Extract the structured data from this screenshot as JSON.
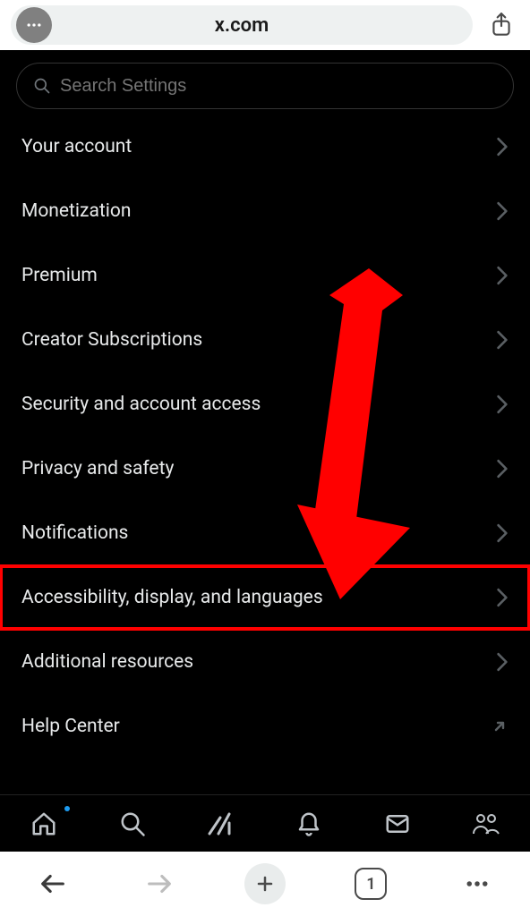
{
  "browser": {
    "url": "x.com",
    "tab_count": "1"
  },
  "search": {
    "placeholder": "Search Settings"
  },
  "settings": {
    "items": [
      {
        "label": "Your account",
        "external": false,
        "highlight": false
      },
      {
        "label": "Monetization",
        "external": false,
        "highlight": false
      },
      {
        "label": "Premium",
        "external": false,
        "highlight": false
      },
      {
        "label": "Creator Subscriptions",
        "external": false,
        "highlight": false
      },
      {
        "label": "Security and account access",
        "external": false,
        "highlight": false
      },
      {
        "label": "Privacy and safety",
        "external": false,
        "highlight": false
      },
      {
        "label": "Notifications",
        "external": false,
        "highlight": false
      },
      {
        "label": "Accessibility, display, and languages",
        "external": false,
        "highlight": true
      },
      {
        "label": "Additional resources",
        "external": false,
        "highlight": false
      },
      {
        "label": "Help Center",
        "external": true,
        "highlight": false
      }
    ]
  },
  "annotation": {
    "arrow_color": "#ff0000",
    "highlight_color": "#ff0000"
  }
}
